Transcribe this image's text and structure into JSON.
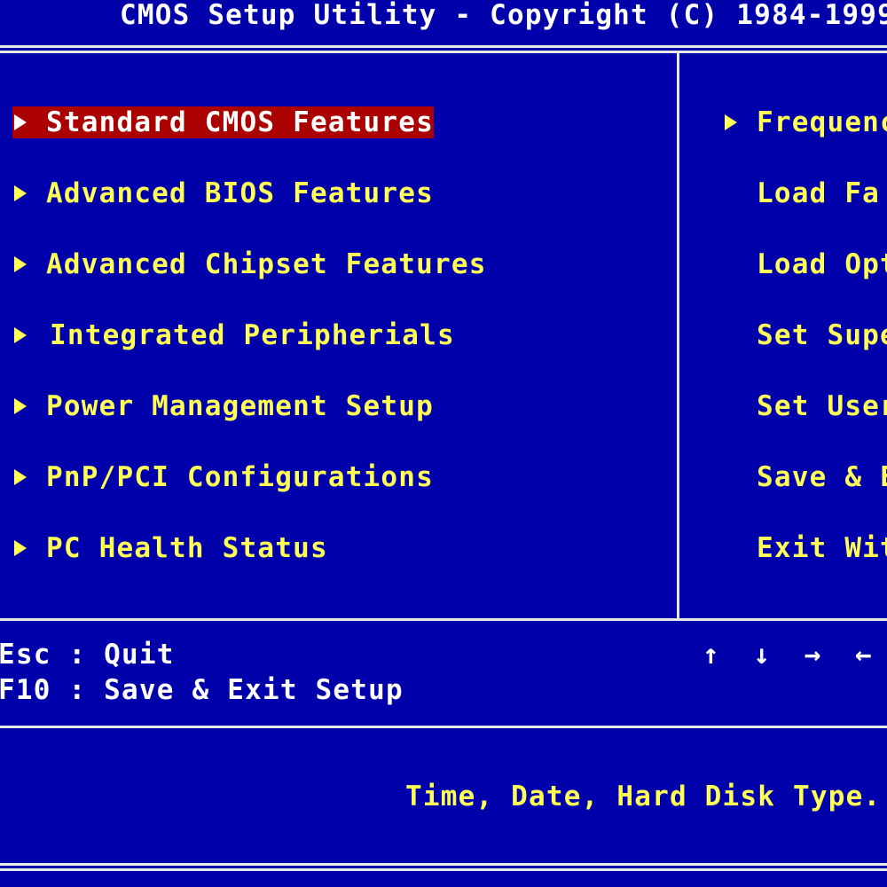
{
  "header": {
    "title": "CMOS Setup Utility - Copyright (C) 1984-1999"
  },
  "left_menu": [
    {
      "label": "Standard CMOS Features",
      "selected": true
    },
    {
      "label": "Advanced BIOS Features"
    },
    {
      "label": "Advanced Chipset Features"
    },
    {
      "label": "Integrated Peripherials"
    },
    {
      "label": "Power Management Setup"
    },
    {
      "label": "PnP/PCI Configurations"
    },
    {
      "label": "PC Health Status"
    }
  ],
  "right_menu": [
    {
      "label": "Frequenc",
      "submenu": true
    },
    {
      "label": "Load Fa"
    },
    {
      "label": "Load Opt"
    },
    {
      "label": "Set Supe"
    },
    {
      "label": "Set User"
    },
    {
      "label": "Save & E"
    },
    {
      "label": "Exit Wit"
    }
  ],
  "keys": {
    "esc": "Esc : Quit",
    "f10": "F10 : Save & Exit Setup",
    "arrows": "↑ ↓ → ←"
  },
  "status": {
    "help_text": "Time, Date, Hard Disk Type..."
  },
  "colors": {
    "background": "#0000aa",
    "text": "#ffff55",
    "highlight": "#aa0000",
    "title": "#ffffff"
  },
  "icons": {
    "submenu": "triangle-right-icon"
  }
}
